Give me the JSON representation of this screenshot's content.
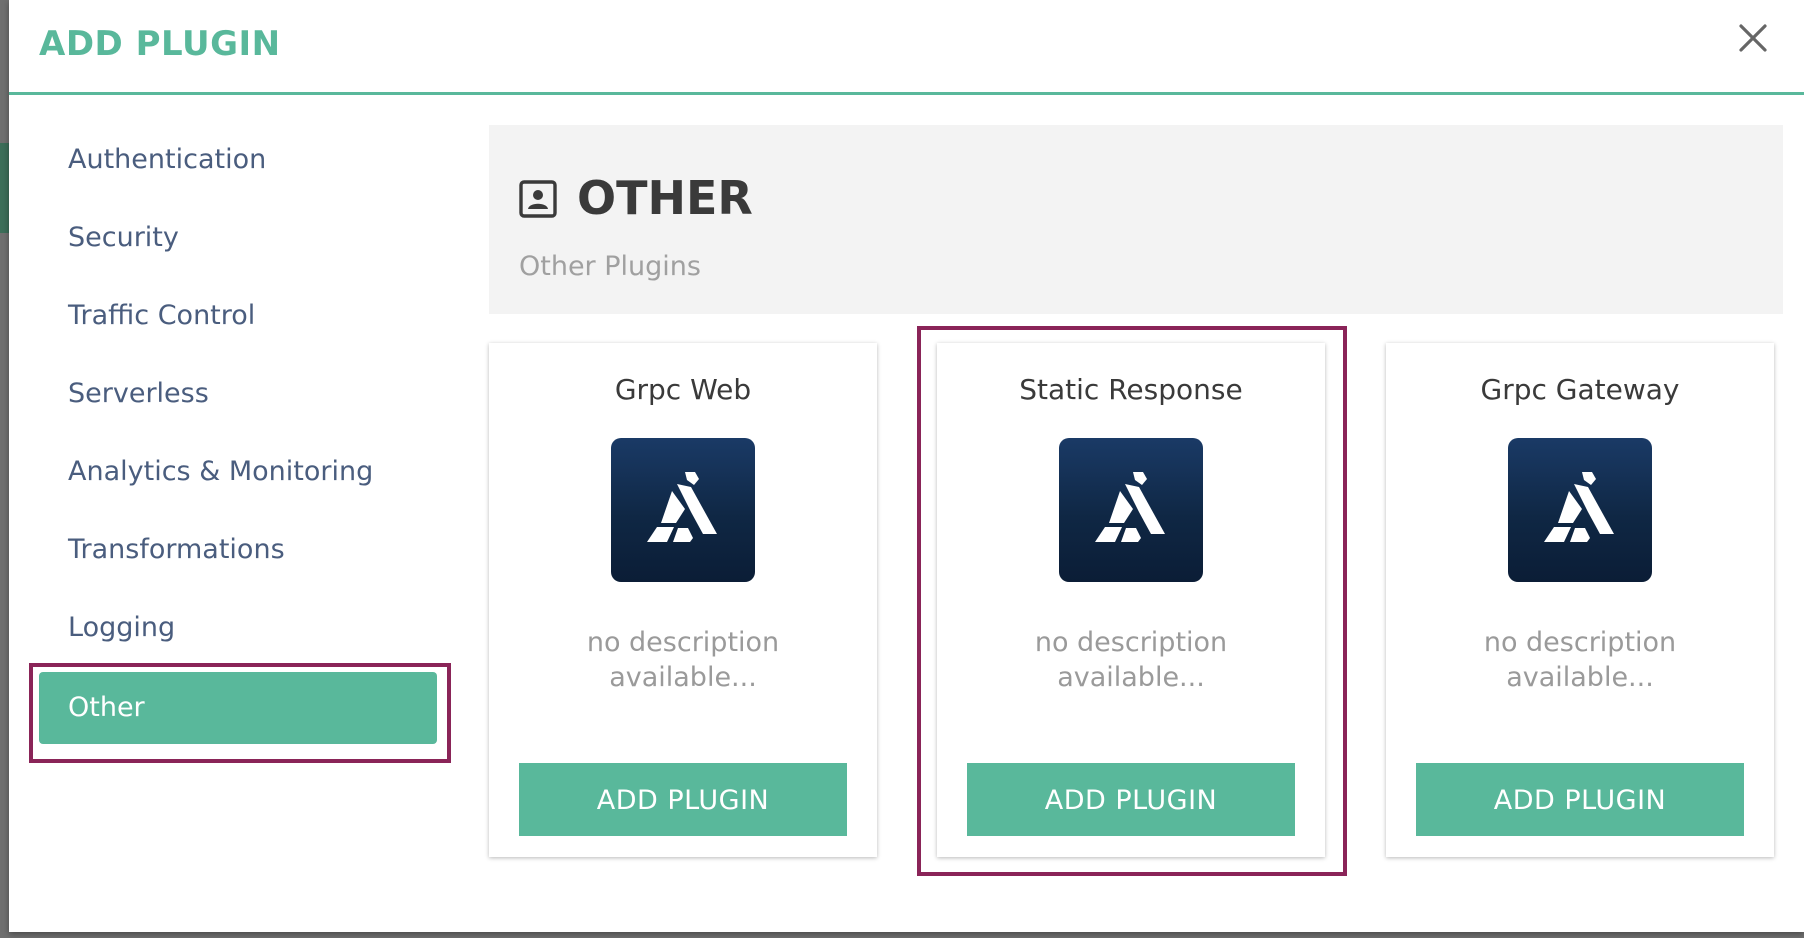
{
  "modal": {
    "title": "ADD PLUGIN",
    "close_icon": "close-icon"
  },
  "sidebar": {
    "items": [
      {
        "label": "Authentication"
      },
      {
        "label": "Security"
      },
      {
        "label": "Traffic Control"
      },
      {
        "label": "Serverless"
      },
      {
        "label": "Analytics & Monitoring"
      },
      {
        "label": "Transformations"
      },
      {
        "label": "Logging"
      },
      {
        "label": "Other"
      }
    ],
    "active_item": "Other"
  },
  "section": {
    "icon": "contact-card-icon",
    "title": "OTHER",
    "subtitle": "Other Plugins"
  },
  "plugins": [
    {
      "name": "Grpc Web",
      "logo": "kong-gorilla-logo",
      "description": "no description available...",
      "button_label": "ADD PLUGIN"
    },
    {
      "name": "Static Response",
      "logo": "kong-gorilla-logo",
      "description": "no description available...",
      "button_label": "ADD PLUGIN"
    },
    {
      "name": "Grpc Gateway",
      "logo": "kong-gorilla-logo",
      "description": "no description available...",
      "button_label": "ADD PLUGIN"
    }
  ],
  "colors": {
    "accent": "#59b89b",
    "nav_text": "#4a5d7e",
    "highlight": "#8a2458",
    "logo_bg": "#0f2744"
  }
}
